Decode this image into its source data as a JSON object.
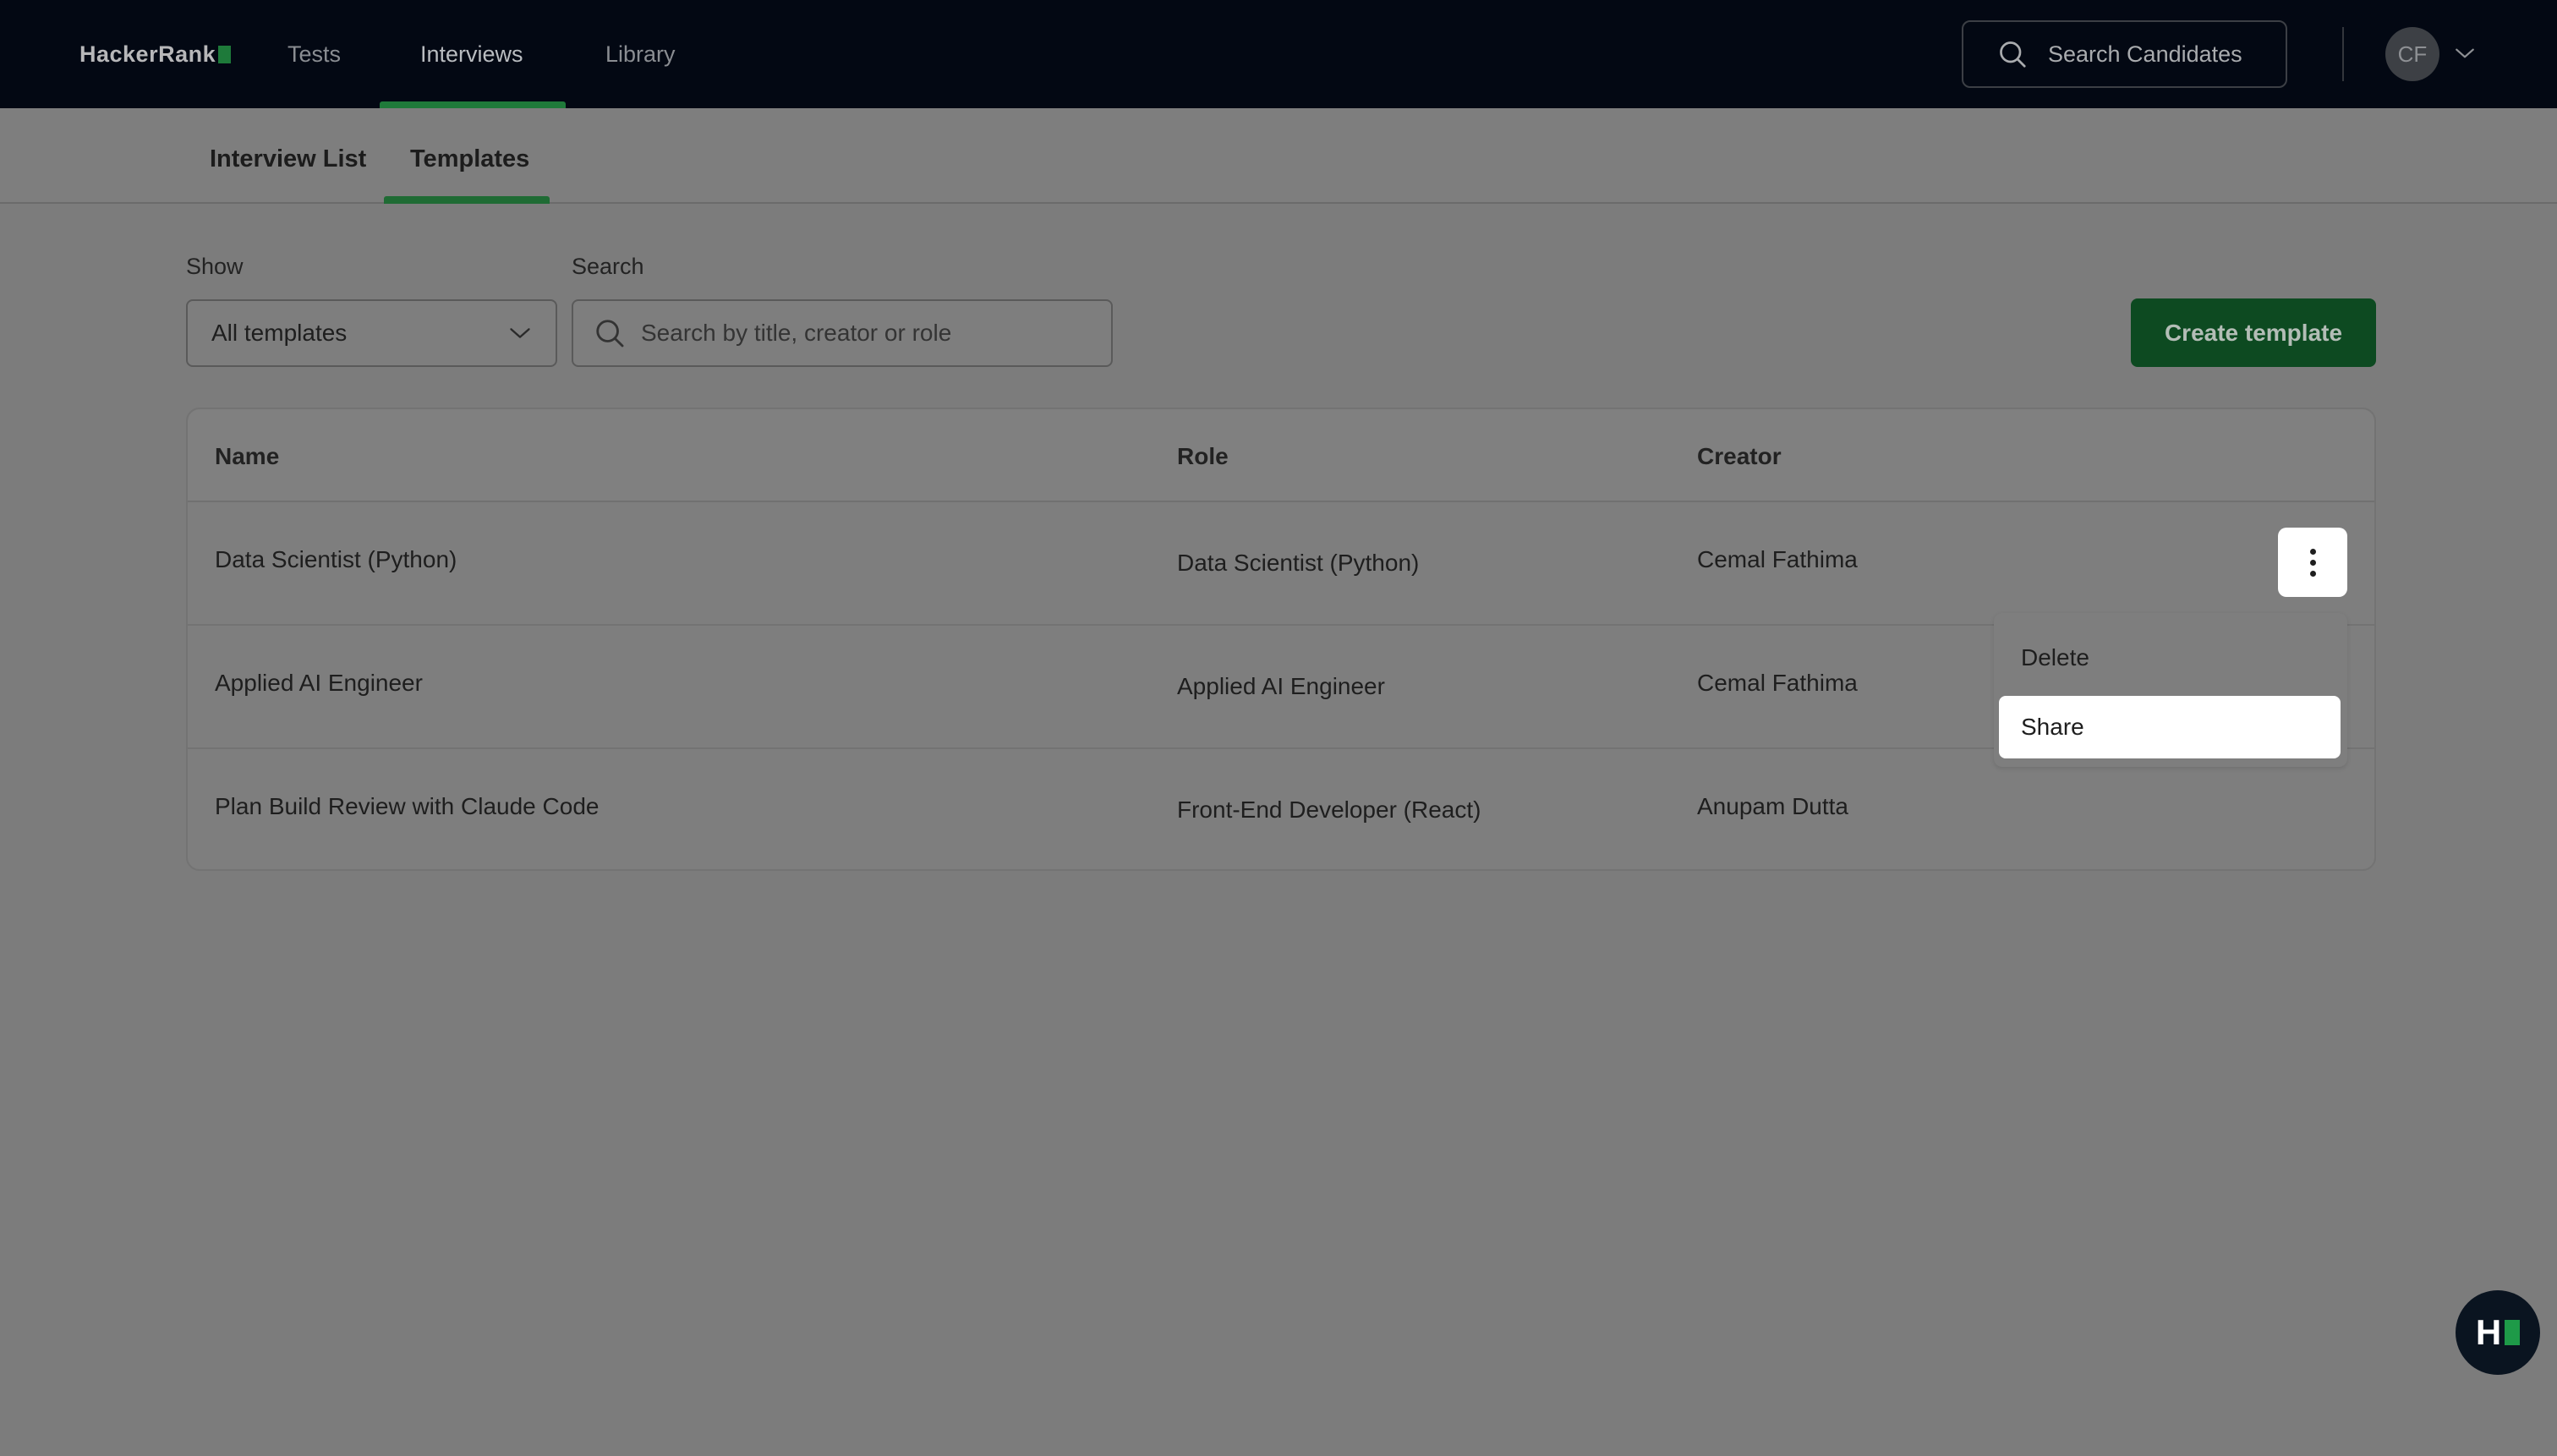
{
  "nav": {
    "brand": "HackerRank",
    "links": [
      "Tests",
      "Interviews",
      "Library"
    ],
    "active_link": "Interviews",
    "search_label": "Search Candidates",
    "avatar_initials": "CF"
  },
  "subtabs": [
    "Interview List",
    "Templates"
  ],
  "active_subtab": "Templates",
  "filters": {
    "show_label": "Show",
    "show_value": "All templates",
    "search_label": "Search",
    "search_placeholder": "Search by title, creator or role"
  },
  "create_button": "Create template",
  "table": {
    "headers": [
      "Name",
      "Role",
      "Creator"
    ],
    "rows": [
      {
        "name": "Data Scientist (Python)",
        "role": "Data Scientist (Python)",
        "creator": "Cemal Fathima"
      },
      {
        "name": "Applied AI Engineer",
        "role": "Applied AI Engineer",
        "creator": "Cemal Fathima"
      },
      {
        "name": "Plan Build Review with Claude Code",
        "role": "Front-End Developer (React)",
        "creator": "Anupam Dutta"
      }
    ]
  },
  "row_menu": {
    "items": [
      "Delete",
      "Share"
    ],
    "highlighted": "Share"
  },
  "help_bubble": "H",
  "colors": {
    "nav_bg": "#030813",
    "accent_green": "#1f7a3a",
    "button_green": "#0d4a21",
    "overlay_gray": "#7e7e7e"
  }
}
